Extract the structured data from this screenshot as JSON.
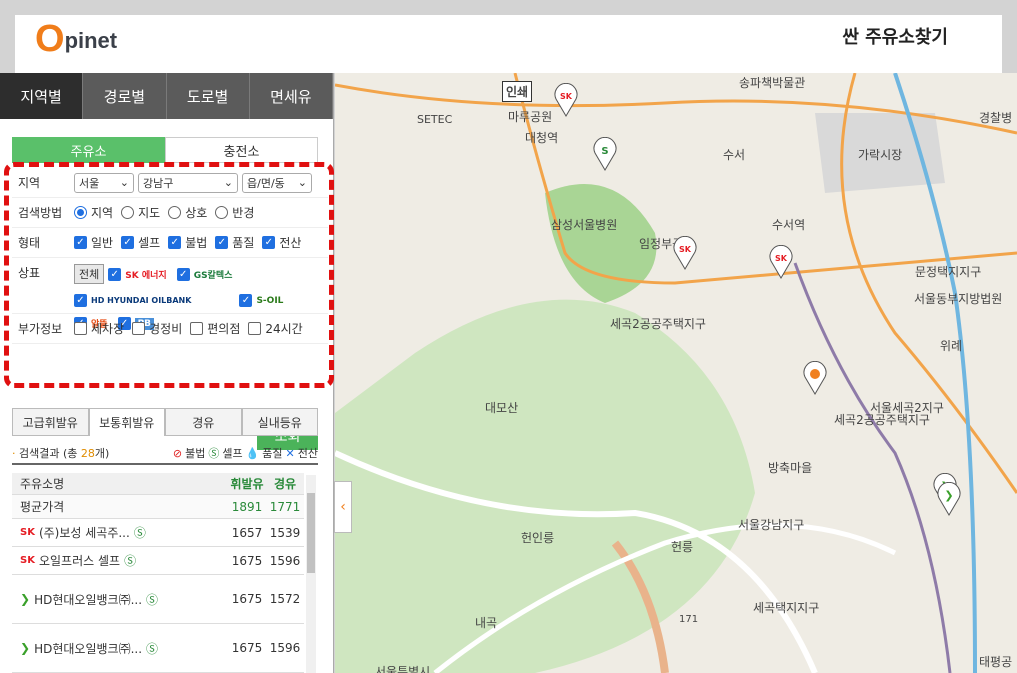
{
  "header": {
    "logo_o": "O",
    "logo_rest": "pinet",
    "title": "싼 주유소찾기"
  },
  "tabs": [
    "지역별",
    "경로별",
    "도로별",
    "면세유"
  ],
  "subtabs": [
    "주유소",
    "충전소"
  ],
  "form": {
    "region_label": "지역",
    "sido": "서울",
    "sigungu": "강남구",
    "dong": "읍/면/동",
    "method_label": "검색방법",
    "methods": [
      "지역",
      "지도",
      "상호",
      "반경"
    ],
    "type_label": "형태",
    "types": [
      "일반",
      "셀프",
      "불법",
      "품질",
      "전산"
    ],
    "brand_label": "상표",
    "all_button": "전체",
    "brands": [
      "SK 에너지",
      "GS칼텍스",
      "HD HYUNDAI OILBANK",
      "S-OIL",
      "알뜰",
      "PB"
    ],
    "extra_label": "부가정보",
    "extras": [
      "세차장",
      "경정비",
      "편의점",
      "24시간"
    ],
    "search_button": "조회"
  },
  "fuel_tabs": [
    "고급휘발유",
    "보통휘발유",
    "경유",
    "실내등유"
  ],
  "result": {
    "prefix": "검색결과 (총",
    "count": "28",
    "suffix": "개)",
    "legend": [
      "불법",
      "셀프",
      "품질",
      "전산"
    ]
  },
  "table": {
    "headers": [
      "주유소명",
      "휘발유",
      "경유"
    ],
    "avg": {
      "name": "평균가격",
      "gasoline": "1891",
      "diesel": "1771"
    },
    "rows": [
      {
        "name": "(주)보성 세곡주...",
        "gasoline": "1657",
        "diesel": "1539"
      },
      {
        "name": "오일프러스 셀프",
        "gasoline": "1675",
        "diesel": "1596"
      },
      {
        "name": "HD현대오일뱅크㈜...",
        "gasoline": "1675",
        "diesel": "1572"
      },
      {
        "name": "HD현대오일뱅크㈜...",
        "gasoline": "1675",
        "diesel": "1596"
      }
    ]
  },
  "map": {
    "print": "인쇄",
    "labels": [
      "송파책박물관",
      "SETEC",
      "마루공원",
      "대청역",
      "수서",
      "가락시장",
      "경찰병",
      "삼성서울병원",
      "임정부공",
      "수서역",
      "문정택지지구",
      "서울동부지방법원",
      "세곡2공공주택지구",
      "위례",
      "대모산",
      "서울세곡2지구",
      "세곡2공공주택지구",
      "방축마을",
      "서울강남지구",
      "헌인릉",
      "헌릉",
      "내곡",
      "171",
      "세곡택지지구",
      "서울특별시",
      "태평공"
    ]
  }
}
